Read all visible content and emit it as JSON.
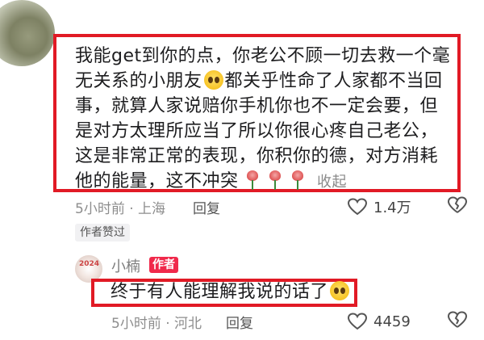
{
  "comment": {
    "text_part1": "我能get到你的点，你老公不顾一切去救一个毫无关系的小朋友",
    "text_part2": "都关乎性命了人家都不当回事，就算人家说赔你手机你也不一定会要，但是对方太理所应当了所以你很心疼自己老公，这是非常正常的表现，你积你的德，对方消耗他的能量，这不冲突",
    "collapse_label": "收起",
    "meta": "5小时前 · 上海",
    "reply_label": "回复",
    "like_count": "1.4万",
    "author_liked_label": "作者赞过"
  },
  "reply": {
    "username": "小楠",
    "author_badge": "作者",
    "avatar_text": "2024",
    "text": "终于有人能理解我说的话了",
    "meta": "5小时前 · 河北",
    "reply_label": "回复",
    "like_count": "4459"
  },
  "icons": {
    "like": "heart-outline-icon",
    "dislike": "broken-heart-icon",
    "cry_emoji": "crying-face-emoji",
    "rose": "rose-emoji"
  },
  "colors": {
    "highlight_border": "#e11a25",
    "author_badge": "#f0294b",
    "meta_gray": "#8d8d8d"
  }
}
